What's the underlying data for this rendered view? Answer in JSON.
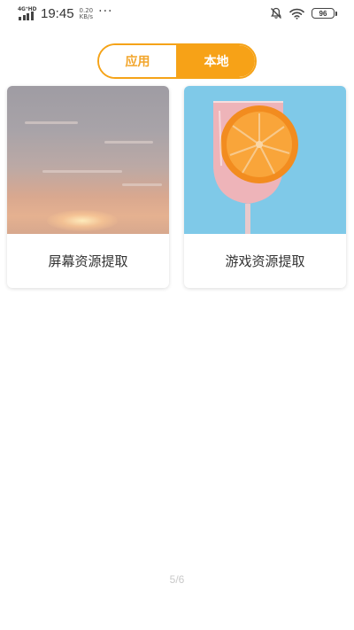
{
  "status_bar": {
    "network": "4G⁺HD",
    "time": "19:45",
    "speed_value": "0.20",
    "speed_unit": "KB/s",
    "more": "···",
    "battery": "96"
  },
  "segment": {
    "app_label": "应用",
    "local_label": "本地",
    "selected": "本地",
    "accent_color": "#f7a217"
  },
  "cards": [
    {
      "label": "屏幕资源提取",
      "image": "sunset-photo"
    },
    {
      "label": "游戏资源提取",
      "image": "orange-drink-photo"
    }
  ],
  "page_indicator": "5/6"
}
